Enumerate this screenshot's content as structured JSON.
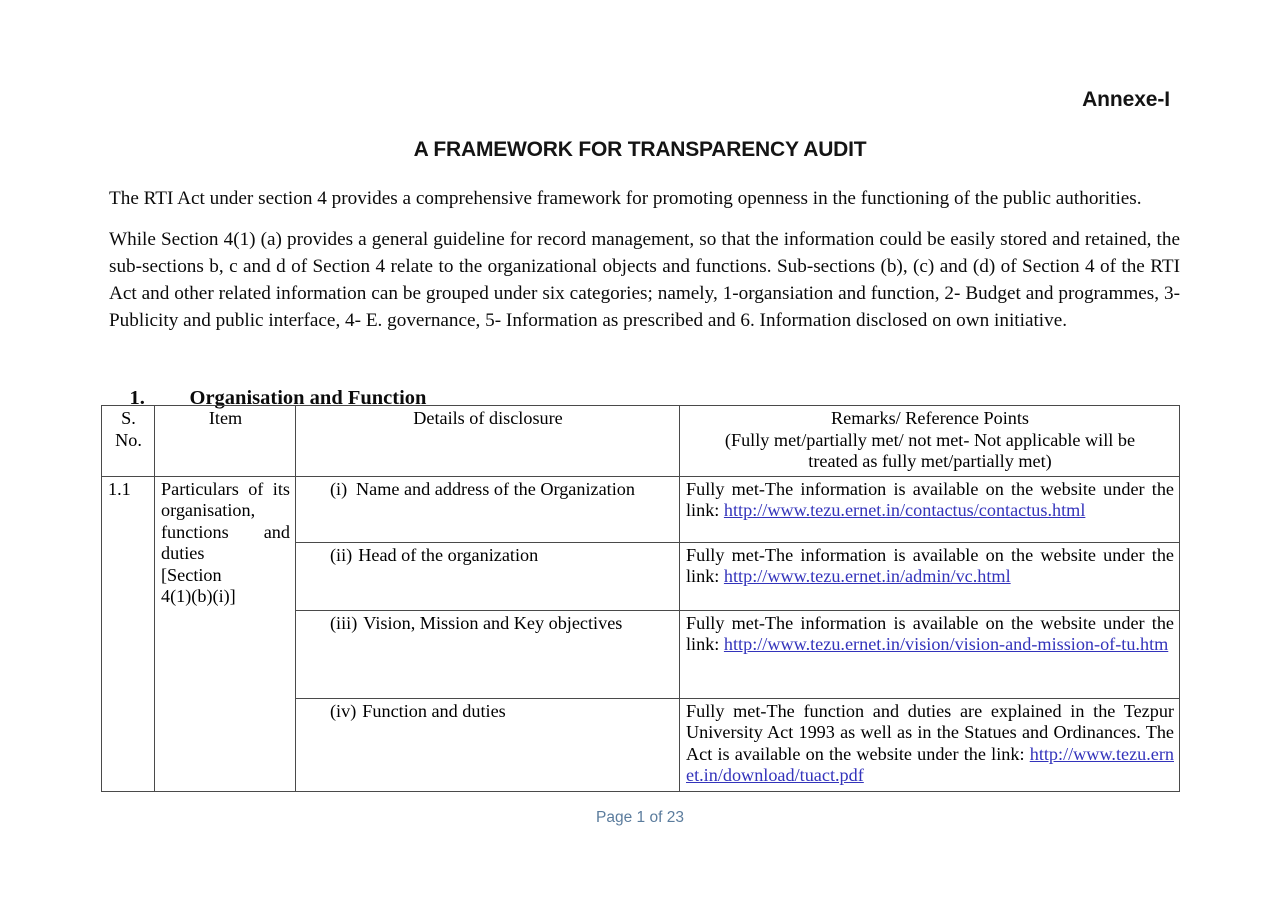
{
  "header": {
    "annexe_label": "Annexe-I",
    "doc_title": "A FRAMEWORK FOR TRANSPARENCY AUDIT"
  },
  "body": {
    "paragraph_1": "The RTI Act under section 4 provides a comprehensive framework for promoting openness in the functioning of the public authorities.",
    "paragraph_2": "While Section 4(1) (a) provides a general guideline for record management, so that the information could be easily stored and retained, the sub-sections b, c and d of Section 4 relate to the organizational objects and functions. Sub-sections (b), (c) and (d) of Section 4 of the RTI Act and other related information can be grouped under six categories; namely, 1-organsiation and function, 2- Budget and programmes, 3- Publicity and public interface, 4- E. governance, 5- Information as prescribed and 6. Information disclosed on own initiative.",
    "section_number": "1.",
    "section_title": "Organisation and Function"
  },
  "table": {
    "headers": {
      "sno_line1": "S.",
      "sno_line2": "No.",
      "item": "Item",
      "details": "Details of disclosure",
      "remarks_line1": "Remarks/ Reference Points",
      "remarks_line2": "(Fully met/partially met/ not met- Not applicable will be",
      "remarks_line3": "treated as fully met/partially met)"
    },
    "rows": [
      {
        "sno": "1.1",
        "item_lines": [
          "Particulars",
          "of",
          "its",
          "organisation,",
          "functions",
          "and",
          "duties",
          "[Section",
          "4(1)(b)(i)]"
        ],
        "item_block_1": "Particulars of its organisation,",
        "item_block_2": "functions and duties",
        "item_block_3": "[Section",
        "item_block_4": "4(1)(b)(i)]",
        "sub_rows": [
          {
            "roman": "(i)",
            "detail": "Name and address of the Organization",
            "remark_prefix": "Fully met-The information is available on the website under the link:",
            "remark_link": "http://www.tezu.ernet.in/contactus/contactus.html"
          },
          {
            "roman": "(ii)",
            "detail": "Head of the organization",
            "remark_prefix": "Fully met-The information is available on the website under the link:",
            "remark_link": "http://www.tezu.ernet.in/admin/vc.html"
          },
          {
            "roman": "(iii)",
            "detail": "Vision, Mission and Key objectives",
            "remark_prefix": "Fully met-The information is available on the website under the link:",
            "remark_link": "http://www.tezu.ernet.in/vision/vision-and-mission-of-tu.htm"
          },
          {
            "roman": "(iv)",
            "detail": "Function and duties",
            "remark_prefix": "Fully met-The function and duties are explained in the Tezpur University Act 1993 as well as in the Statues and Ordinances. The Act is available on the website under the link:",
            "remark_link": "http://www.tezu.ernet.in/download/tuact.pdf"
          }
        ]
      }
    ]
  },
  "footer": {
    "page_label": "Page 1 of 23"
  },
  "colors": {
    "link": "#3333bb",
    "footer_text": "#5b7c9d",
    "table_border": "#4a4a4a",
    "body_text": "#0b0b0b"
  }
}
